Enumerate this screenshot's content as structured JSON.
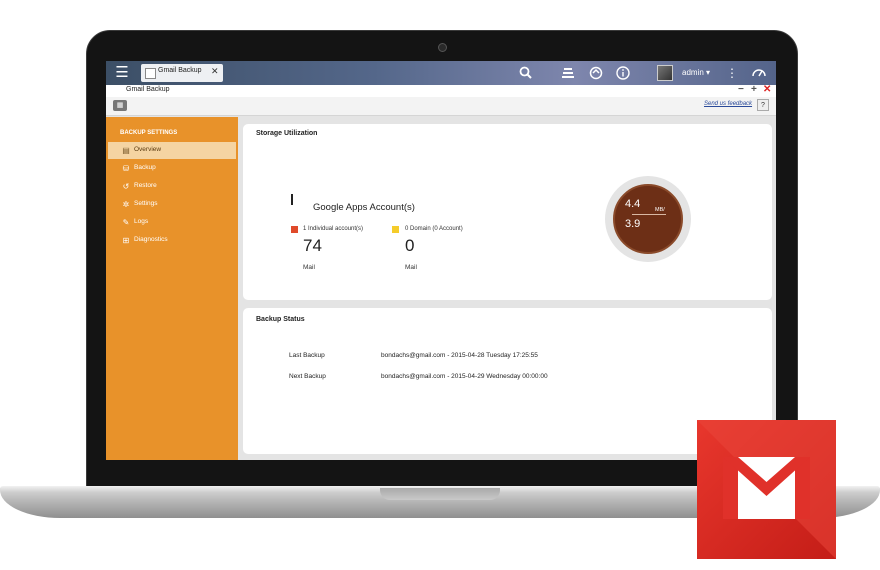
{
  "window": {
    "tab_title": "Gmail Backup",
    "app_title": "Gmail Backup"
  },
  "header": {
    "username": "admin",
    "username_caret": "▾"
  },
  "toolbar": {
    "feedback_link": "Send us feedback",
    "help_label": "?"
  },
  "sidebar": {
    "heading": "BACKUP SETTINGS",
    "items": [
      {
        "label": "Overview",
        "icon": "overview-icon",
        "active": true
      },
      {
        "label": "Backup",
        "icon": "backup-icon",
        "active": false
      },
      {
        "label": "Restore",
        "icon": "restore-icon",
        "active": false
      },
      {
        "label": "Settings",
        "icon": "gear-icon",
        "active": false
      },
      {
        "label": "Logs",
        "icon": "logs-icon",
        "active": false
      },
      {
        "label": "Diagnostics",
        "icon": "diagnostics-icon",
        "active": false
      }
    ]
  },
  "storage": {
    "title": "Storage Utilization",
    "accounts_heading": "Google Apps Account(s)",
    "individual": {
      "label": "1 Individual account(s)",
      "value": "74",
      "unit": "Mail",
      "color": "#e04a2a"
    },
    "domain": {
      "label": "0 Domain (0 Account)",
      "value": "0",
      "unit": "Mail",
      "color": "#f5cc2a"
    },
    "gauge": {
      "top_value": "4.4",
      "unit": "MB/",
      "bottom_value": "3.9",
      "color": "#6d2f16"
    }
  },
  "backup_status": {
    "title": "Backup Status",
    "rows": [
      {
        "label": "Last Backup",
        "value": "bondachs@gmail.com - 2015-04-28 Tuesday 17:25:55"
      },
      {
        "label": "Next Backup",
        "value": "bondachs@gmail.com - 2015-04-29 Wednesday 00:00:00"
      }
    ]
  },
  "colors": {
    "accent": "#e8922a",
    "topbar": "#54678a",
    "gmail": "#d9261c"
  }
}
